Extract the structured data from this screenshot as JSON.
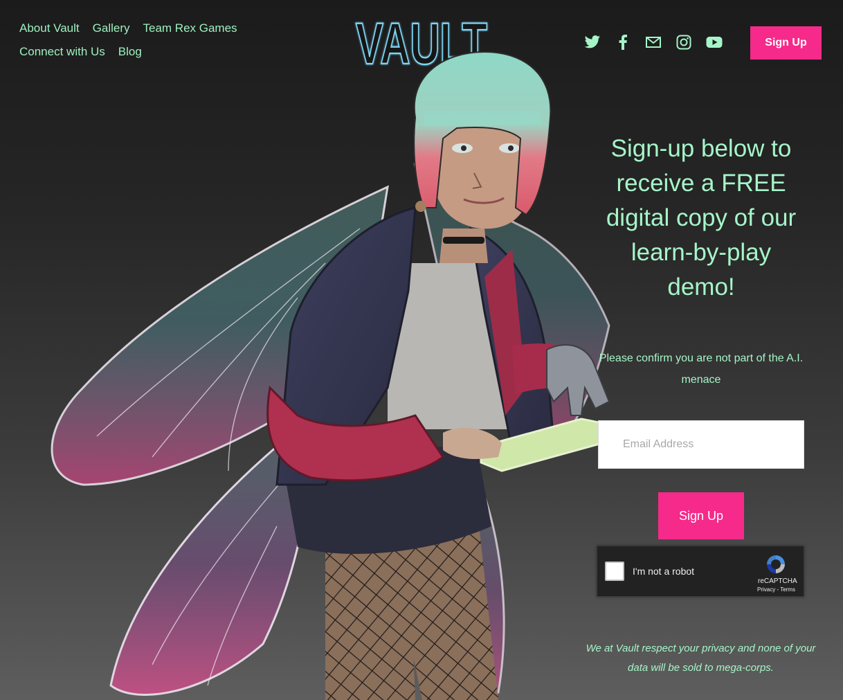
{
  "nav": {
    "items": [
      {
        "label": "About Vault"
      },
      {
        "label": "Gallery"
      },
      {
        "label": "Team Rex Games"
      },
      {
        "label": "Connect with Us"
      },
      {
        "label": "Blog"
      }
    ]
  },
  "logo": {
    "text": "VAULT"
  },
  "social": {
    "icons": [
      "twitter-icon",
      "facebook-icon",
      "email-icon",
      "instagram-icon",
      "youtube-icon"
    ]
  },
  "header": {
    "signup_label": "Sign Up"
  },
  "signup_panel": {
    "headline": "Sign-up below to receive a FREE digital copy of our learn-by-play demo!",
    "confirm_text": "Please confirm you are not part of the A.I. menace",
    "email_placeholder": "Email Address",
    "signup_label": "Sign Up",
    "privacy_note": "We at Vault respect your privacy and none of your data will be sold to mega-corps."
  },
  "captcha": {
    "label": "I'm not a robot",
    "brand": "reCAPTCHA",
    "links": "Privacy - Terms"
  },
  "colors": {
    "accent": "#f52a8a",
    "text_mint": "#a6f5c9",
    "background_top": "#1b1b1b",
    "background_bottom": "#5e5e5e"
  }
}
